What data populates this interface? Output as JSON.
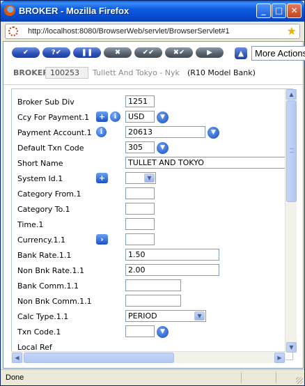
{
  "window": {
    "title": "BROKER - Mozilla Firefox",
    "buttons": [
      "minimize-icon",
      "maximize-icon",
      "close-icon"
    ]
  },
  "address_bar": {
    "url": "http://localhost:8080/BrowserWeb/servlet/BrowserServlet#1",
    "loading_icon": "loading-icon",
    "bookmark_icon": "star-icon"
  },
  "toolbar": {
    "buttons": [
      "✔",
      "?✔",
      "❚❚",
      "✖",
      "✔✔",
      "✖✔",
      "▶"
    ],
    "up_icon": "up-arrow-icon",
    "more_actions": "More Actions"
  },
  "header": {
    "label": "BROKER",
    "id": "100253",
    "name": "Tullett And Tokyo - Nyk",
    "bank": "(R10 Model Bank)"
  },
  "form": {
    "broker_sub_div": {
      "label": "Broker Sub Div",
      "value": "1251"
    },
    "ccy_for_payment": {
      "label": "Ccy For Payment.1",
      "value": "USD"
    },
    "payment_account": {
      "label": "Payment Account.1",
      "value": "20613"
    },
    "default_txn_code": {
      "label": "Default Txn Code",
      "value": "305"
    },
    "short_name": {
      "label": "Short Name",
      "value": "TULLET AND TOKYO"
    },
    "system_id": {
      "label": "System Id.1",
      "value": ""
    },
    "category_from": {
      "label": "Category From.1",
      "value": ""
    },
    "category_to": {
      "label": "Category To.1",
      "value": ""
    },
    "time": {
      "label": "Time.1",
      "value": ""
    },
    "currency": {
      "label": "Currency.1.1",
      "value": ""
    },
    "bank_rate": {
      "label": "Bank Rate.1.1",
      "value": "1.50"
    },
    "non_bnk_rate": {
      "label": "Non Bnk Rate.1.1",
      "value": "2.00"
    },
    "bank_comm": {
      "label": "Bank Comm.1.1",
      "value": ""
    },
    "non_bnk_comm": {
      "label": "Non Bnk Comm.1.1",
      "value": ""
    },
    "calc_type": {
      "label": "Calc Type.1.1",
      "value": "PERIOD"
    },
    "txn_code": {
      "label": "Txn Code.1",
      "value": ""
    },
    "local_ref": {
      "label": "Local Ref"
    }
  },
  "status": {
    "text": "Done"
  }
}
